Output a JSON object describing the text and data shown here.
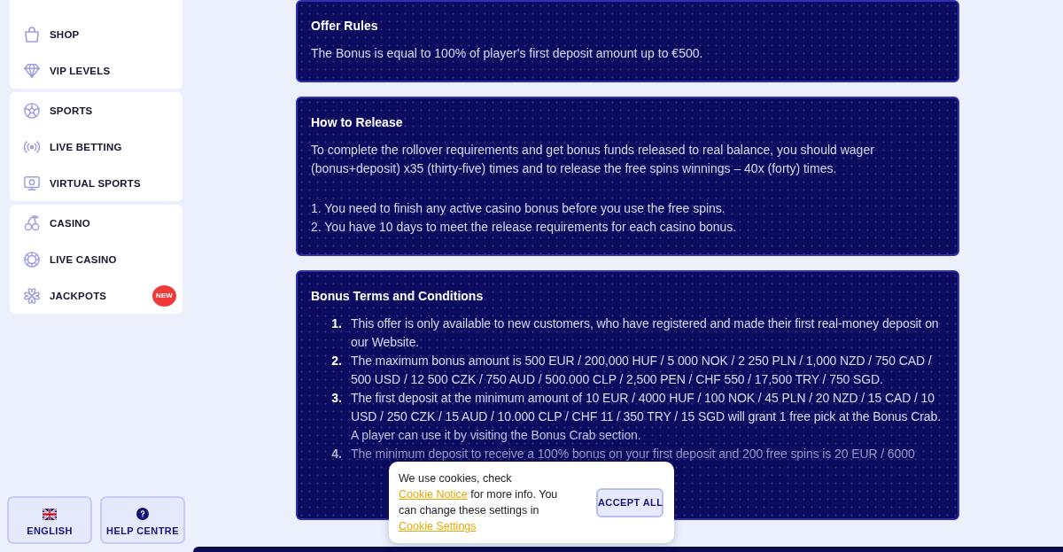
{
  "sidebar": {
    "groups": [
      {
        "items": [
          {
            "label": "SHOP"
          },
          {
            "label": "VIP LEVELS"
          }
        ]
      },
      {
        "items": [
          {
            "label": "SPORTS"
          },
          {
            "label": "LIVE BETTING"
          },
          {
            "label": "VIRTUAL SPORTS"
          }
        ]
      },
      {
        "items": [
          {
            "label": "CASINO"
          },
          {
            "label": "LIVE CASINO"
          },
          {
            "label": "JACKPOTS",
            "badge": "NEW"
          }
        ]
      }
    ],
    "footer_buttons": [
      {
        "label": "ENGLISH"
      },
      {
        "label": "HELP CENTRE"
      }
    ]
  },
  "sections": [
    {
      "title": "Offer Rules",
      "blocks": [
        {
          "kind": "paragraph",
          "text": "The Bonus is equal to 100% of player's first deposit amount up to €500."
        }
      ]
    },
    {
      "title": "How to Release",
      "blocks": [
        {
          "kind": "paragraph",
          "text": "To complete the rollover requirements and get bonus funds released to real balance, you should wager (bonus+deposit) x35 (thirty-five) times and to release the free spins winnings – 40x (forty) times."
        },
        {
          "kind": "lines",
          "lines": [
            "1. You need to finish any active casino bonus before you use the free spins.",
            "2. You have 10 days to meet the release requirements for each casino bonus."
          ]
        }
      ]
    },
    {
      "title": "Bonus Terms and Conditions",
      "blocks": [
        {
          "kind": "numbered_list",
          "items": [
            {
              "number": "1.",
              "text": "This offer is only available to new customers, who have registered and made their first real-money deposit on our Website."
            },
            {
              "number": "2.",
              "text": "The maximum bonus amount is 500 EUR / 200,000 HUF / 5 000 NOK / 2 250 PLN / 1,000 NZD / 750 CAD / 500 USD / 12 500 CZK / 750 AUD / 500.000 CLP / 2,500 PEN / CHF 550 / 17,500 TRY / 750 SGD."
            },
            {
              "number": "3.",
              "text": "The first deposit at the minimum amount of 10 EUR / 4000 HUF / 100 NOK / 45 PLN / 20 NZD / 15 CAD / 10 USD / 250 CZK / 15 AUD / 10.000 CLP / CHF 11 / 350 TRY / 15 SGD will grant 1 free pick at the Bonus Crab. A player can use it by visiting the Bonus Crab section."
            },
            {
              "number": "4.",
              "text": "The minimum deposit to receive a 100% bonus on your first deposit and 200 free spins is 20 EUR / 6000"
            }
          ]
        }
      ]
    }
  ],
  "cookie_banner": {
    "message": [
      {
        "kind": "text",
        "text": "We use cookies, check"
      },
      {
        "kind": "link",
        "text": "Cookie Notice"
      },
      {
        "kind": "text",
        "text": "for more info. You can change these settings in"
      },
      {
        "kind": "link",
        "text": "Cookie Settings"
      }
    ],
    "button": "ACCEPT ALL"
  }
}
